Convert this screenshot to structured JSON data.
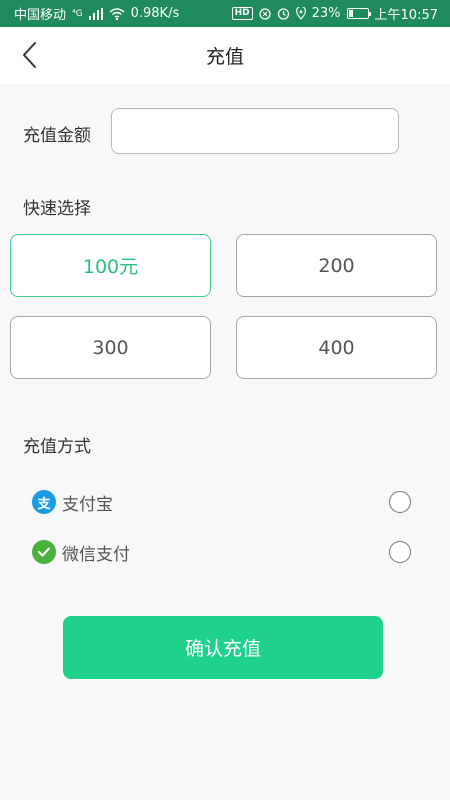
{
  "status_bar": {
    "carrier": "中国移动",
    "network": "⁴G",
    "speed": "0.98K/s",
    "hd": "HD",
    "battery_percent": "23%",
    "battery_level": 0.23,
    "time": "上午10:57"
  },
  "header": {
    "title": "充值",
    "back_icon": "chevron-left-icon"
  },
  "amount": {
    "label": "充值金额",
    "value": "",
    "placeholder": ""
  },
  "quick_select": {
    "label": "快速选择",
    "options": [
      "100元",
      "200",
      "300",
      "400"
    ],
    "selected_index": 0,
    "accent_color": "#3ecf8e"
  },
  "payment": {
    "label": "充值方式",
    "methods": [
      {
        "name": "支付宝",
        "icon": "alipay-icon",
        "color": "#1a9be8",
        "glyph": "支",
        "selected": false
      },
      {
        "name": "微信支付",
        "icon": "wechat-pay-icon",
        "color": "#4caf3e",
        "glyph": "✔",
        "selected": false
      }
    ]
  },
  "confirm": {
    "label": "确认充值",
    "color": "#1fd18a"
  }
}
